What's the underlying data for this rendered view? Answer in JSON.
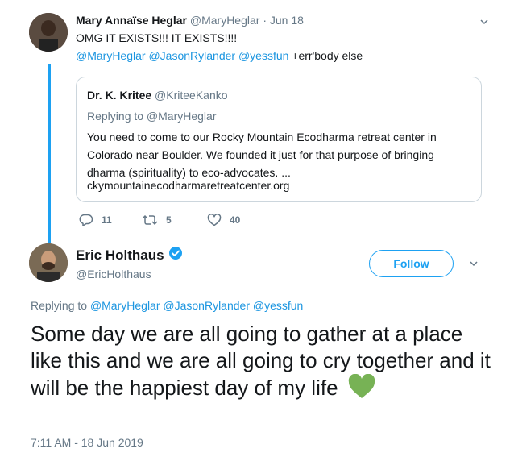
{
  "parent_tweet": {
    "name": "Mary Annaïse Heglar",
    "handle": "@MaryHeglar",
    "date": "· Jun 18",
    "text_line1": "OMG IT EXISTS!!! IT EXISTS!!!!",
    "mentions": "@MaryHeglar @JasonRylander @yessfun",
    "mentions_suffix": " +err'body else",
    "quoted": {
      "name": "Dr. K. Kritee",
      "handle": "@KriteeKanko",
      "replying_to": "Replying to @MaryHeglar",
      "line1": "You need to come to our Rocky Mountain Ecodharma retreat center in",
      "line2": "Colorado near Boulder. We founded it just for that purpose of bringing",
      "line3": "dharma (spirituality) to eco-advocates. ...",
      "line4": "ckymountainecodharmaretreatcenter.org"
    },
    "actions": {
      "replies": "11",
      "retweets": "5",
      "likes": "40"
    }
  },
  "main_tweet": {
    "name": "Eric Holthaus",
    "handle": "@EricHolthaus",
    "follow_label": "Follow",
    "replying_prefix": "Replying to ",
    "replying_mentions": "@MaryHeglar @JasonRylander @yessfun",
    "body": "Some day we are all going to gather at a place like this and we are all going to cry together and it will be the happiest day of my life",
    "emoji_icon": "green-heart-icon",
    "timestamp": "7:11 AM - 18 Jun 2019"
  },
  "colors": {
    "accent": "#1da1f2",
    "link": "#1b95e0",
    "muted": "#657786",
    "heart": "#77b255"
  }
}
